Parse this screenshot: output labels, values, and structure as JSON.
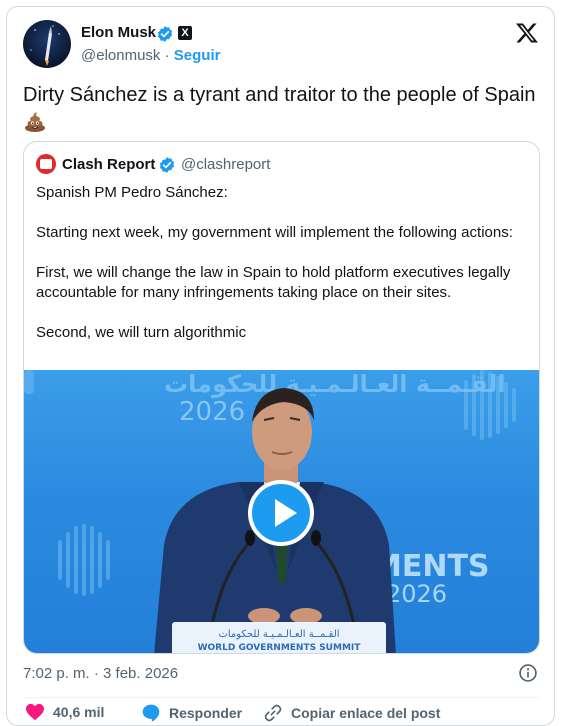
{
  "author": {
    "name": "Elon Musk",
    "handle": "@elonmusk",
    "separator": "·",
    "follow_label": "Seguir"
  },
  "tweet": {
    "text": "Dirty Sánchez is a tyrant and traitor to the people of Spain",
    "emoji_icon": "pile-of-poo-icon"
  },
  "quote": {
    "name": "Clash Report",
    "handle": "@clashreport",
    "paragraphs": [
      "Spanish PM Pedro Sánchez:",
      "Starting next week, my government will implement the following actions:",
      "First, we will change the law in Spain to hold platform executives legally accountable for many infringements taking place on their sites.",
      "Second, we will turn algorithmic"
    ],
    "media": {
      "backdrop_year": "2026",
      "backdrop_word": "MENTS",
      "backdrop_year_right": "2026",
      "arabic_banner": "القـمــة العـالـمـيـة للحكومات",
      "podium_text": "WORLD GOVERNMENTS SUMMIT"
    }
  },
  "footer": {
    "timestamp": "7:02 p. m. · 3 feb. 2026",
    "likes": "40,6 mil",
    "reply_label": "Responder",
    "copy_label": "Copiar enlace del post"
  },
  "colors": {
    "accent": "#1d9bf0",
    "like": "#f91880",
    "text": "#0f1419",
    "muted": "#536471"
  }
}
